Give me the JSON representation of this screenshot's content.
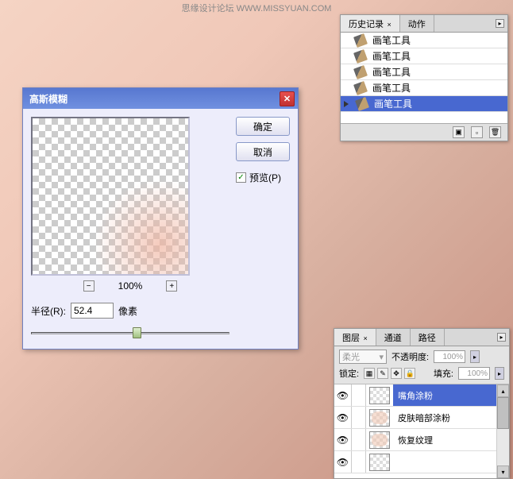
{
  "watermark": "思缘设计论坛  WWW.MISSYUAN.COM",
  "gauss": {
    "title": "高斯模糊",
    "ok": "确定",
    "cancel": "取消",
    "preview_label": "预览(P)",
    "zoom": "100%",
    "radius_label": "半径(R):",
    "radius_value": "52.4",
    "radius_unit": "像素"
  },
  "history": {
    "tabs": [
      "历史记录",
      "动作"
    ],
    "items": [
      "画笔工具",
      "画笔工具",
      "画笔工具",
      "画笔工具",
      "画笔工具"
    ]
  },
  "layers": {
    "tabs": [
      "图层",
      "通道",
      "路径"
    ],
    "blend_mode": "柔光",
    "opacity_label": "不透明度:",
    "opacity_value": "100%",
    "lock_label": "锁定:",
    "fill_label": "填充:",
    "fill_value": "100%",
    "items": [
      "嘴角涂粉",
      "皮肤暗部涂粉",
      "恢复纹理"
    ]
  }
}
